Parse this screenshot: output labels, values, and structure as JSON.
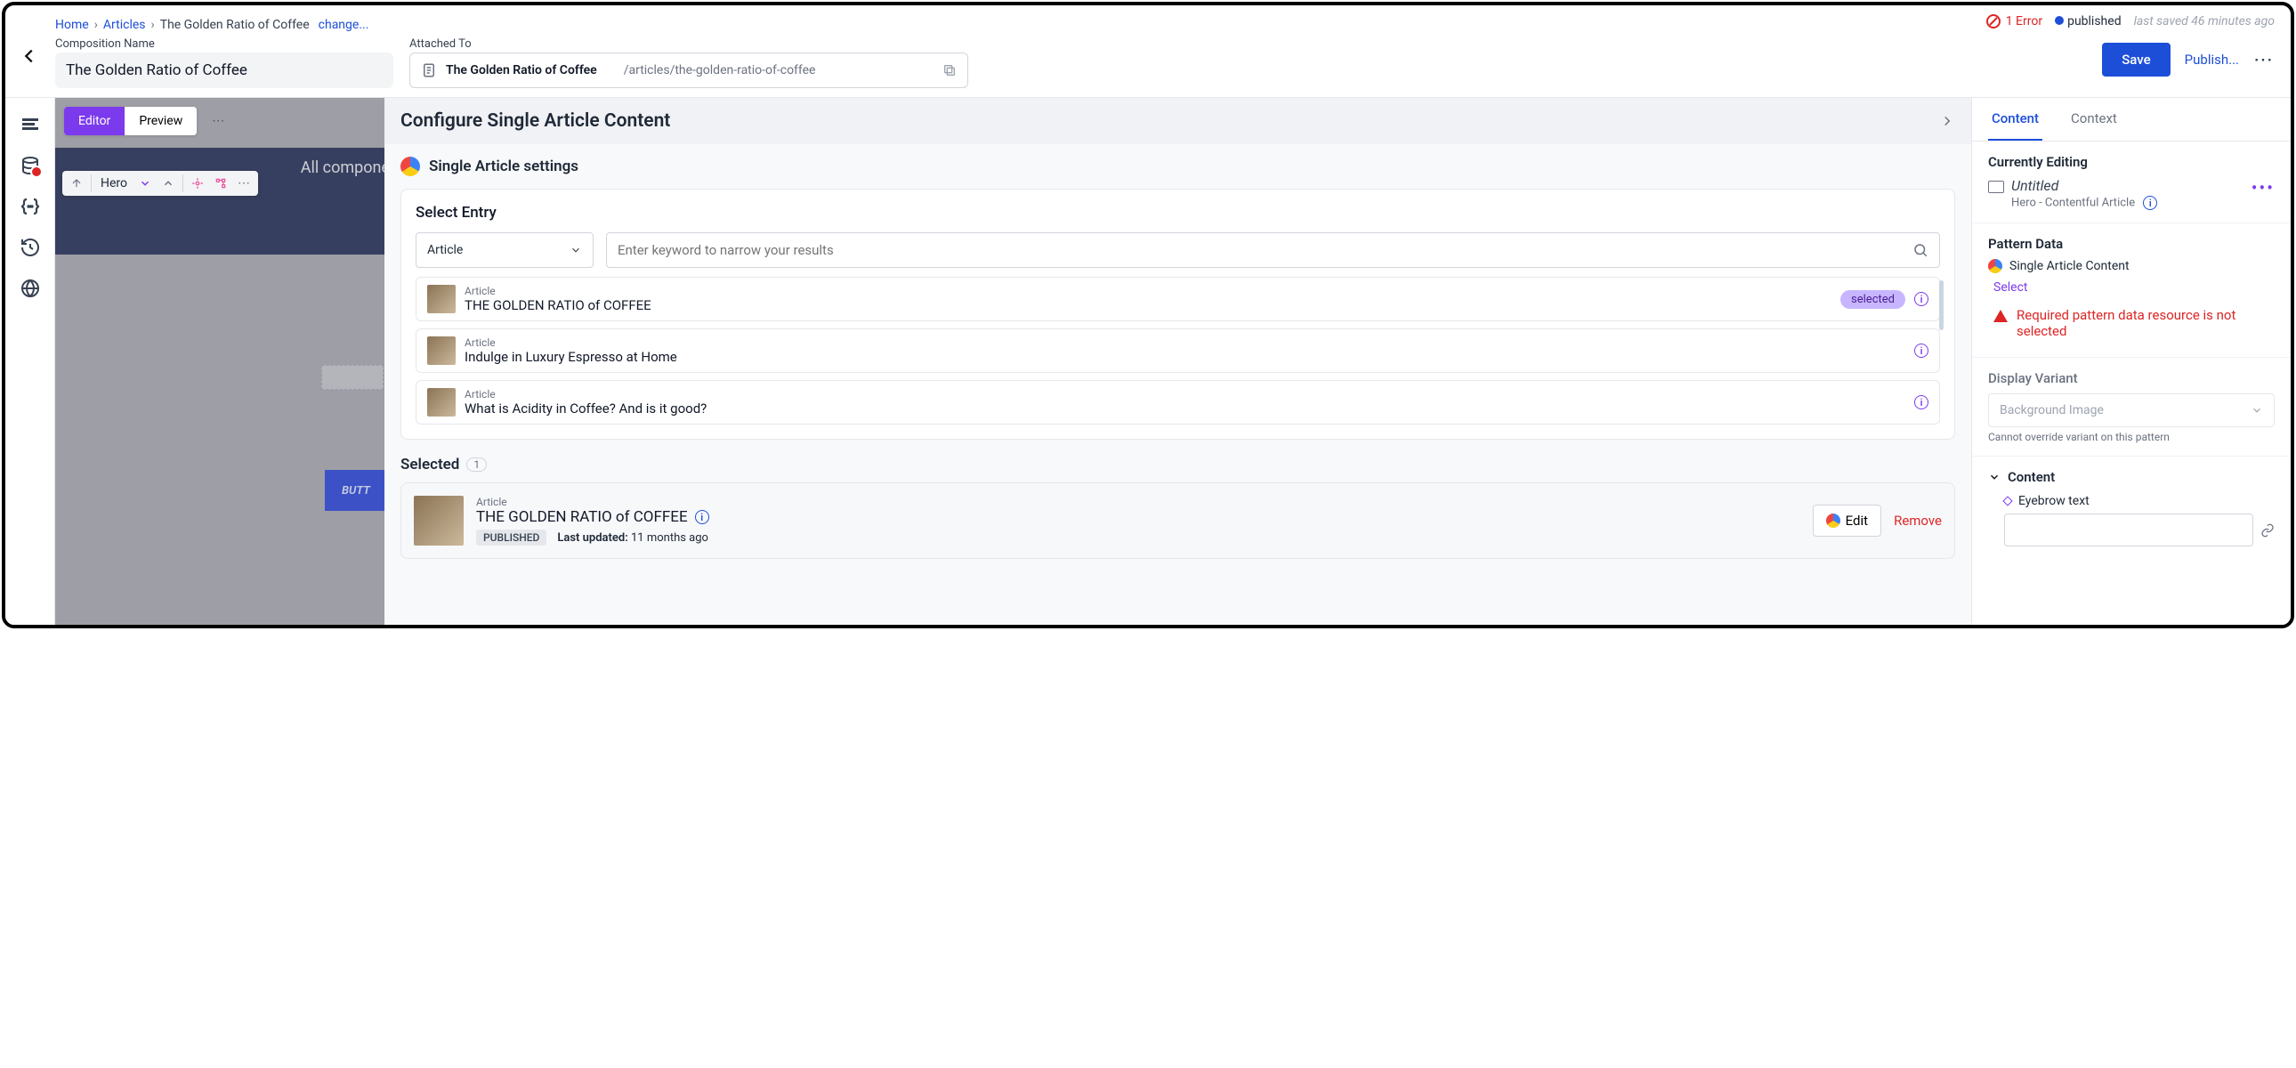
{
  "breadcrumb": {
    "home": "Home",
    "articles": "Articles",
    "current": "The Golden Ratio of Coffee",
    "change": "change..."
  },
  "status": {
    "error_count": "1 Error",
    "state": "published",
    "saved": "last saved 46 minutes ago"
  },
  "actions": {
    "save": "Save",
    "publish": "Publish..."
  },
  "fields": {
    "comp_name_label": "Composition Name",
    "comp_name_value": "The Golden Ratio of Coffee",
    "attached_label": "Attached To",
    "attached_title": "The Golden Ratio of Coffee",
    "attached_path": "/articles/the-golden-ratio-of-coffee"
  },
  "canvas": {
    "editor_tab": "Editor",
    "preview_tab": "Preview",
    "banner_text": "All compone",
    "hero_label": "Hero",
    "button_label": "BUTT"
  },
  "config": {
    "panel_title": "Configure Single Article Content",
    "settings_title": "Single Article settings",
    "select_entry": "Select Entry",
    "type_filter": "Article",
    "search_placeholder": "Enter keyword to narrow your results",
    "selected_badge": "selected",
    "entries": [
      {
        "type": "Article",
        "title": "THE GOLDEN RATIO of COFFEE",
        "selected": true
      },
      {
        "type": "Article",
        "title": "Indulge in Luxury Espresso at Home",
        "selected": false
      },
      {
        "type": "Article",
        "title": "What is Acidity in Coffee? And is it good?",
        "selected": false
      }
    ],
    "selected_heading": "Selected",
    "selected_count": "1",
    "selected_item": {
      "type": "Article",
      "title": "THE GOLDEN RATIO of COFFEE",
      "status": "PUBLISHED",
      "updated_label": "Last updated:",
      "updated_value": "11 months ago",
      "edit": "Edit",
      "remove": "Remove"
    }
  },
  "right": {
    "tabs": {
      "content": "Content",
      "context": "Context"
    },
    "editing_head": "Currently Editing",
    "editing_title": "Untitled",
    "editing_sub": "Hero - Contentful Article",
    "pattern_head": "Pattern Data",
    "pattern_name": "Single Article Content",
    "select_action": "Select",
    "error_msg": "Required pattern data resource is not selected",
    "variant_head": "Display Variant",
    "variant_value": "Background Image",
    "variant_hint": "Cannot override variant on this pattern",
    "content_head": "Content",
    "eyebrow_label": "Eyebrow text"
  }
}
